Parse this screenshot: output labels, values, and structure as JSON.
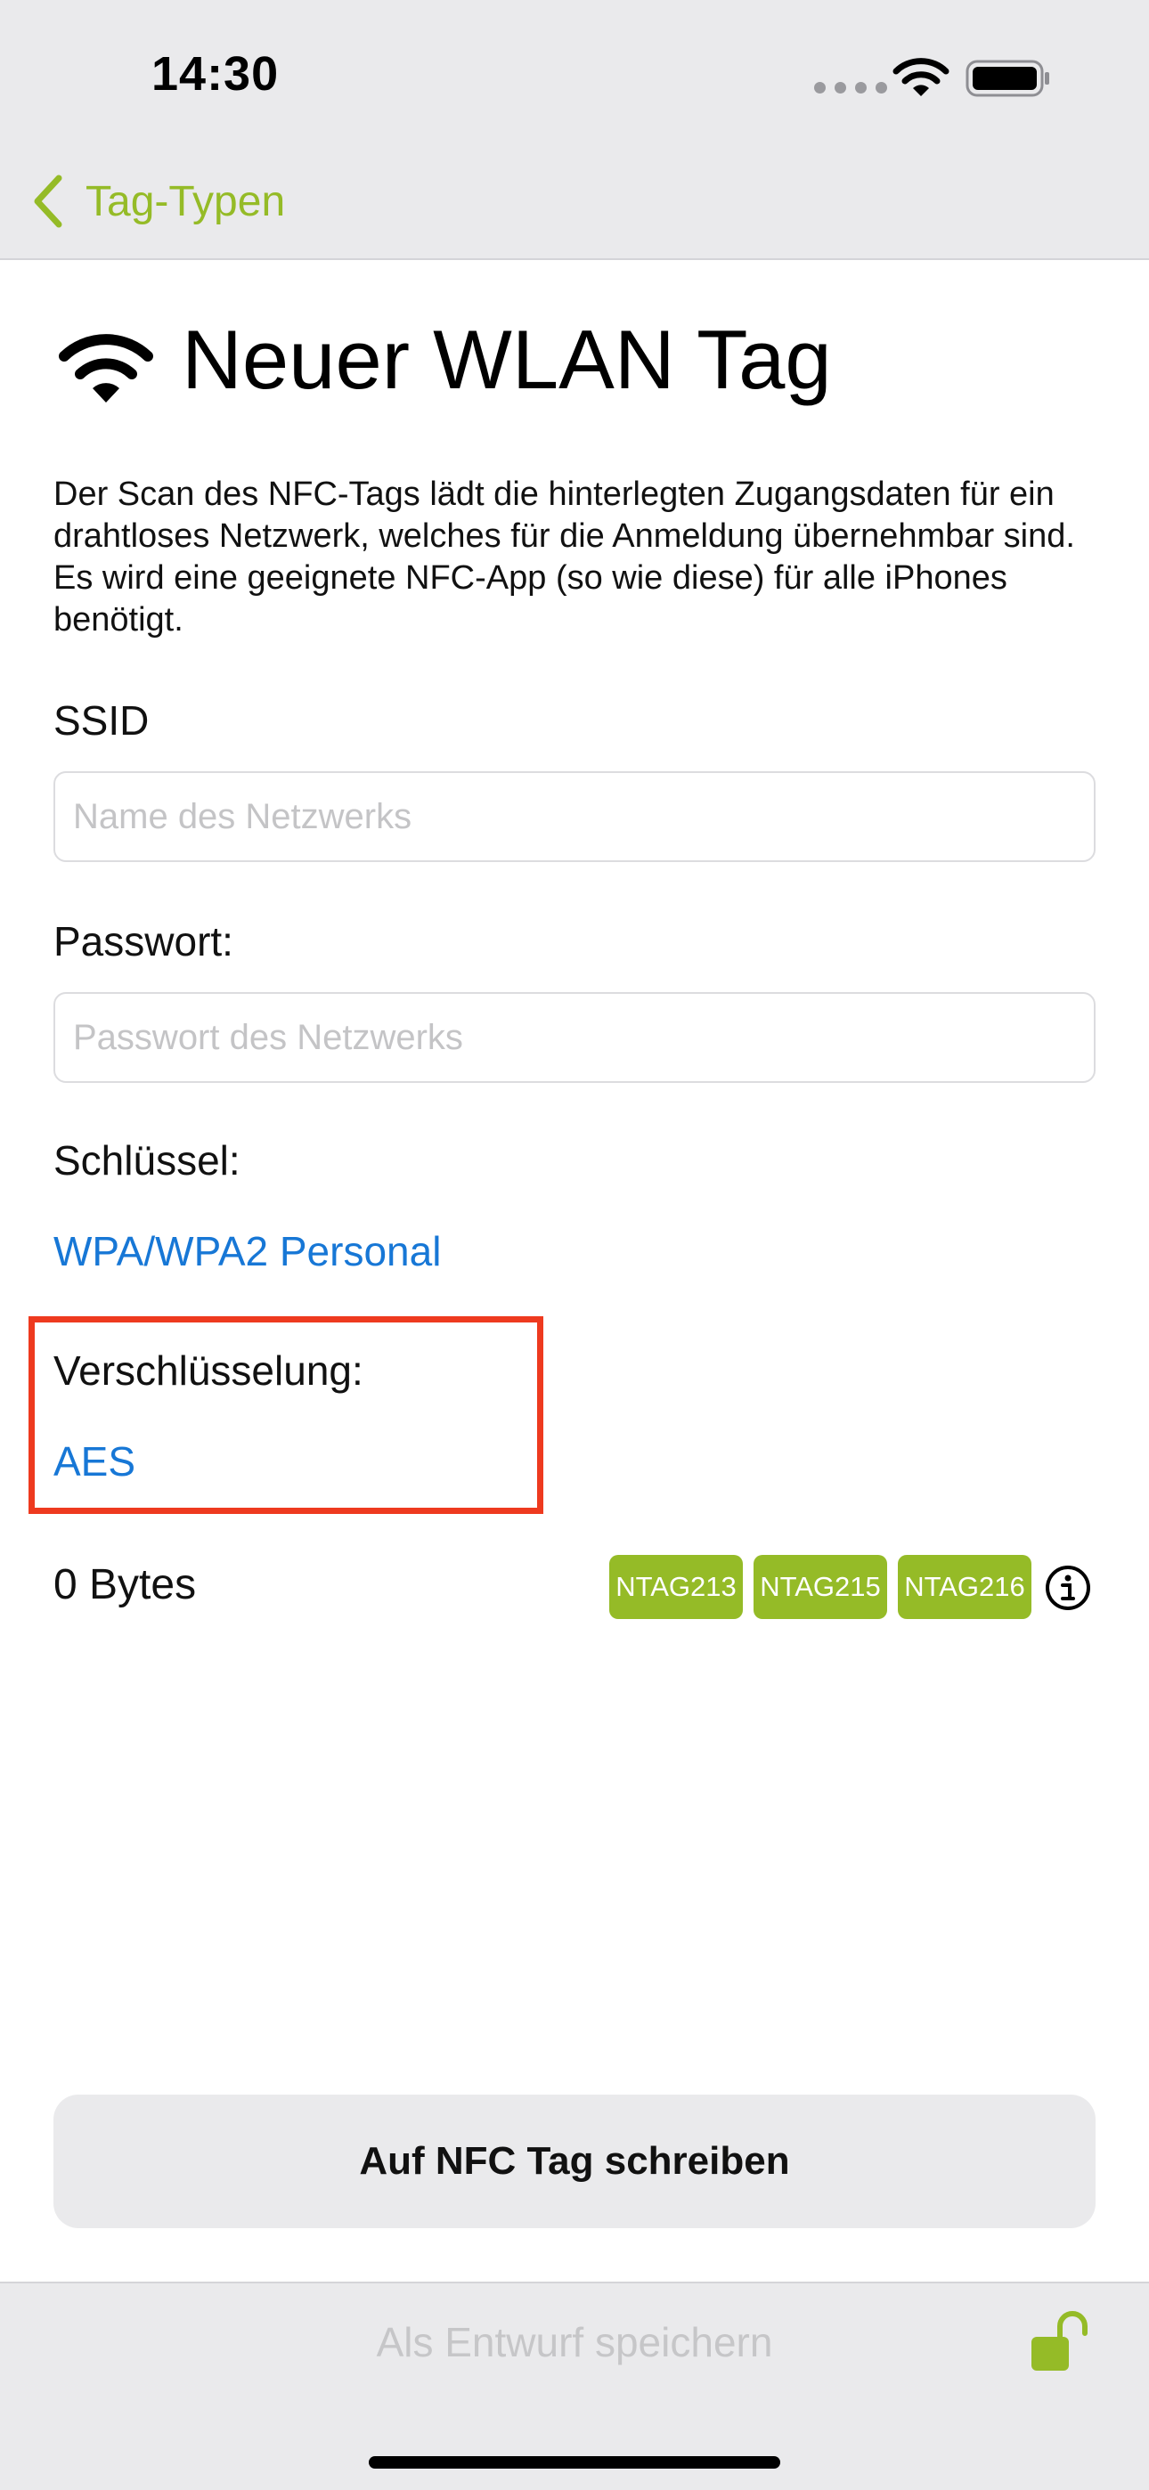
{
  "status_bar": {
    "time": "14:30"
  },
  "nav": {
    "back_label": "Tag-Typen"
  },
  "header": {
    "title": "Neuer WLAN Tag",
    "icon": "wifi-icon"
  },
  "description": "Der Scan des NFC-Tags lädt die hinterlegten Zugangsdaten für ein drahtloses Netzwerk, welches für die Anmeldung übernehmbar sind. Es wird eine geeignete NFC-App (so wie diese) für alle iPhones benötigt.",
  "form": {
    "ssid": {
      "label": "SSID",
      "placeholder": "Name des Netzwerks",
      "value": ""
    },
    "password": {
      "label": "Passwort:",
      "placeholder": "Passwort des Netzwerks",
      "value": ""
    },
    "key": {
      "label": "Schlüssel:",
      "value": "WPA/WPA2 Personal"
    },
    "encryption": {
      "label": "Verschlüsselung:",
      "value": "AES"
    }
  },
  "size": {
    "label": "0 Bytes",
    "badges": [
      "NTAG213",
      "NTAG215",
      "NTAG216"
    ]
  },
  "actions": {
    "write_label": "Auf NFC Tag schreiben",
    "draft_label": "Als Entwurf speichern"
  },
  "colors": {
    "accent_green": "#95bb27",
    "link_blue": "#1777d6",
    "highlight_red": "#ee3a1f"
  }
}
